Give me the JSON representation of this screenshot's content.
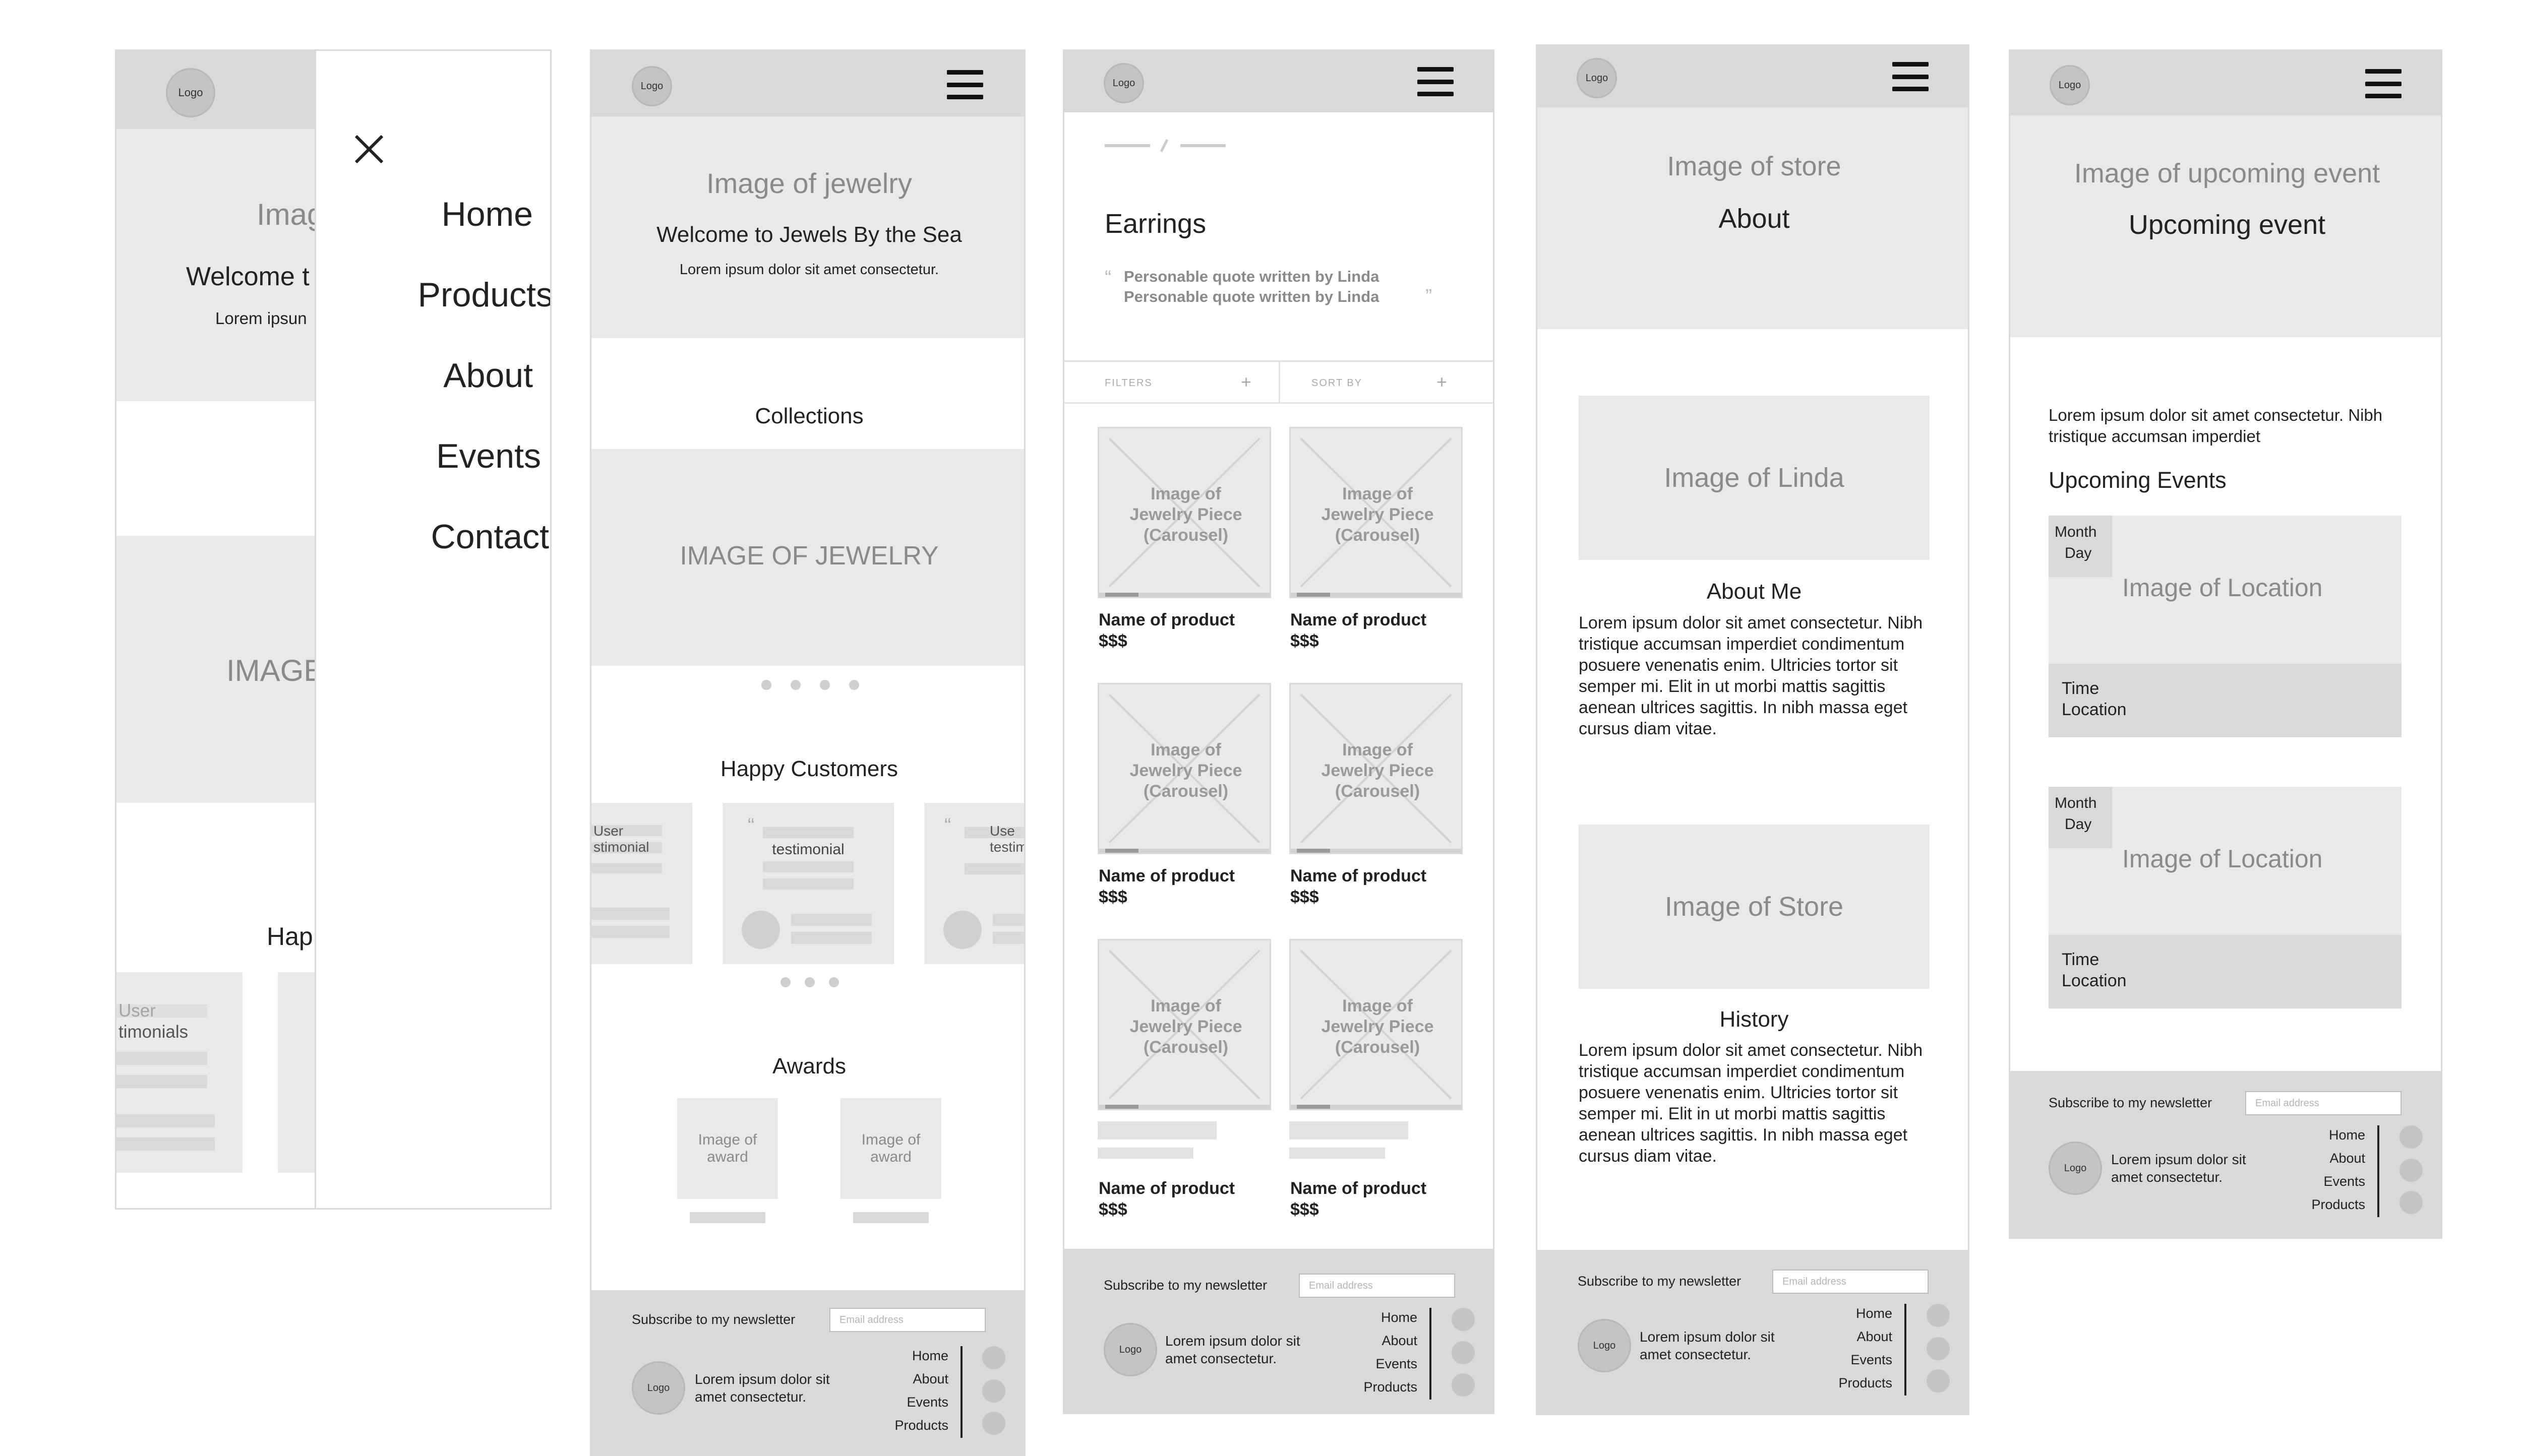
{
  "logo": "Logo",
  "menu_screen": {
    "close": "×",
    "hero_partial": "Imag",
    "welcome_partial": "Welcome t",
    "lorem_partial": "Lorem ipsun",
    "image_partial": "IMAGE",
    "happy_partial": "Hap",
    "testimonial_partial": [
      "User",
      "timonials"
    ],
    "menu": [
      "Home",
      "Products",
      "About",
      "Events",
      "Contact"
    ]
  },
  "home": {
    "hero_image": "Image of jewelry",
    "welcome": "Welcome to Jewels By the Sea",
    "lorem": "Lorem ipsum dolor sit amet consectetur.",
    "collections": "Collections",
    "collection_image": "IMAGE OF JEWELRY",
    "happy_customers": "Happy Customers",
    "testimonial_left": [
      "User",
      "stimonial"
    ],
    "testimonial_mid": "testimonial",
    "testimonial_right": [
      "Use",
      "testimo"
    ],
    "awards": "Awards",
    "award_label": "Image of award"
  },
  "products": {
    "title": "Earrings",
    "quote_lines": [
      "Personable quote written by Linda",
      "Personable quote written by Linda"
    ],
    "filters": "FILTERS",
    "sort_by": "SORT BY",
    "plus": "+",
    "product_image": "Image of Jewelry Piece (Carousel)",
    "product_name": "Name of product",
    "price": "$$$"
  },
  "about": {
    "hero_image": "Image of store",
    "hero_title": "About",
    "linda_image": "Image of Linda",
    "about_me": "About Me",
    "about_text": "Lorem ipsum dolor sit amet consectetur. Nibh tristique accumsan imperdiet condimentum posuere venenatis enim. Ultricies tortor sit semper mi. Elit in ut morbi mattis sagittis aenean ultrices sagittis. In nibh massa eget cursus diam vitae.",
    "store_image": "Image of Store",
    "history": "History",
    "history_text": "Lorem ipsum dolor sit amet consectetur. Nibh tristique accumsan imperdiet condimentum posuere venenatis enim. Ultricies tortor sit semper mi. Elit in ut morbi mattis sagittis aenean ultrices sagittis. In nibh massa eget cursus diam vitae."
  },
  "events": {
    "hero_image": "Image of upcoming event",
    "hero_title": "Upcoming event",
    "lorem": "Lorem ipsum dolor sit amet consectetur. Nibh tristique accumsan imperdiet",
    "upcoming": "Upcoming Events",
    "month": "Month",
    "day": "Day",
    "location_image": "Image of Location",
    "time": "Time",
    "location": "Location"
  },
  "footer": {
    "subscribe": "Subscribe to my newsletter",
    "email_placeholder": "Email address",
    "lorem": "Lorem ipsum dolor sit amet consectetur.",
    "links": [
      "Home",
      "About",
      "Events",
      "Products"
    ]
  }
}
